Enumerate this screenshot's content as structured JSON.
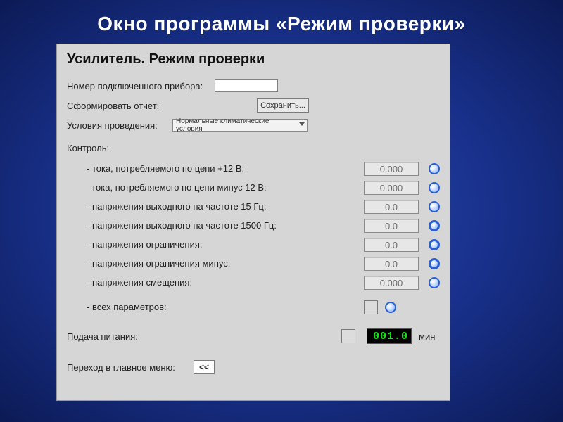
{
  "slide": {
    "title": "Окно программы «Режим проверки»"
  },
  "panel": {
    "title": "Усилитель. Режим проверки",
    "device_number_label": "Номер подключенного прибора:",
    "device_number_value": "",
    "report_label": "Сформировать отчет:",
    "save_button": "Сохранить...",
    "conditions_label": "Условия проведения:",
    "conditions_selected": "Нормальные климатические условия",
    "control_label": "Контроль:",
    "controls": [
      {
        "label": "- тока, потребляемого по цепи +12 В:",
        "value": "0.000"
      },
      {
        "label": "  тока, потребляемого по цепи минус 12 В:",
        "value": "0.000"
      },
      {
        "label": "- напряжения выходного на частоте 15 Гц:",
        "value": "0.0"
      },
      {
        "label": "- напряжения выходного на частоте 1500 Гц:",
        "value": "0.0"
      },
      {
        "label": "- напряжения ограничения:",
        "value": "0.0"
      },
      {
        "label": "- напряжения ограничения минус:",
        "value": "0.0"
      },
      {
        "label": "- напряжения смещения:",
        "value": "0.000"
      }
    ],
    "all_params_label": "- всех параметров:",
    "power_label": "Подача питания:",
    "power_value": "001.0",
    "power_unit": "мин",
    "back_label": "Переход в главное меню:",
    "back_button": "<<"
  }
}
